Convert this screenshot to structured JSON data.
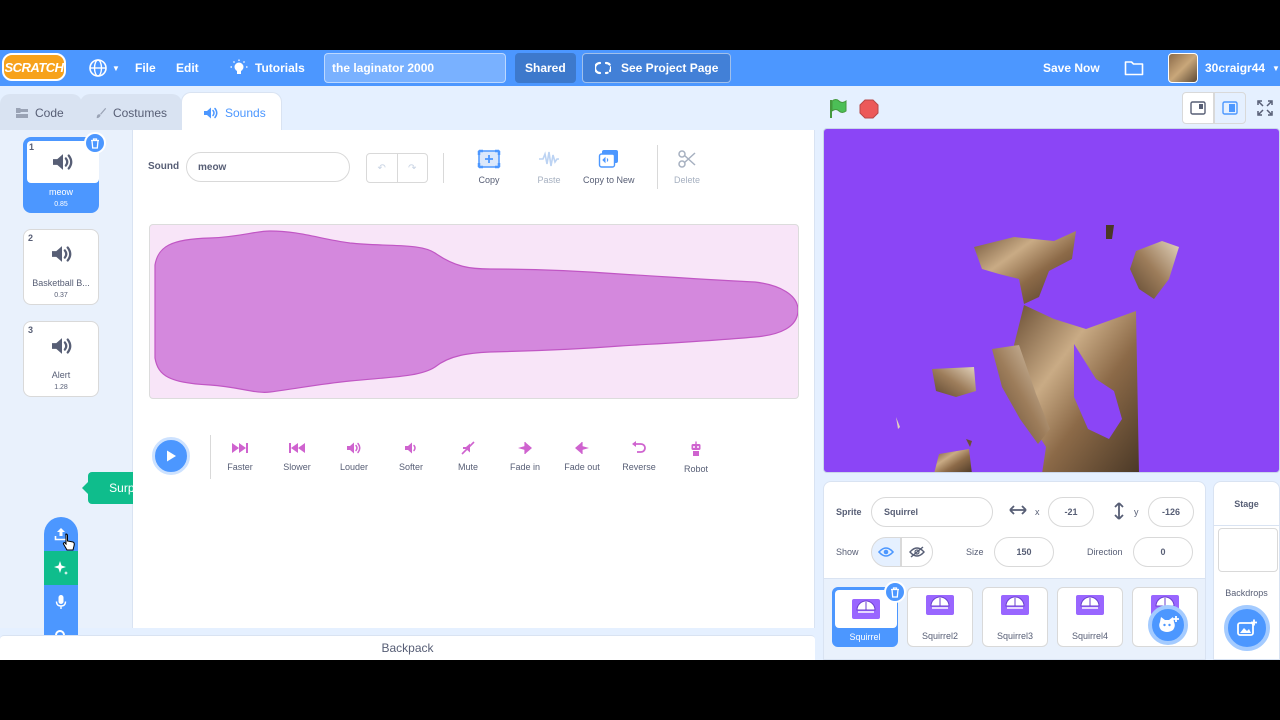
{
  "menubar": {
    "logo": "SCRATCH",
    "file": "File",
    "edit": "Edit",
    "tutorials": "Tutorials",
    "project_title": "the laginator 2000",
    "shared": "Shared",
    "see_project": "See Project Page",
    "save_now": "Save Now",
    "username": "30craigr44"
  },
  "tabs": {
    "code": "Code",
    "costumes": "Costumes",
    "sounds": "Sounds"
  },
  "sounds": [
    {
      "num": "1",
      "name": "meow",
      "duration": "0.85"
    },
    {
      "num": "2",
      "name": "Basketball B...",
      "duration": "0.37"
    },
    {
      "num": "3",
      "name": "Alert",
      "duration": "1.28"
    }
  ],
  "tooltip": "Surprise",
  "editor": {
    "sound_label": "Sound",
    "sound_name": "meow",
    "tools": {
      "copy": "Copy",
      "paste": "Paste",
      "copy_to_new": "Copy to New",
      "delete": "Delete"
    },
    "effects": [
      "Faster",
      "Slower",
      "Louder",
      "Softer",
      "Mute",
      "Fade in",
      "Fade out",
      "Reverse",
      "Robot"
    ]
  },
  "backpack": "Backpack",
  "sprite_info": {
    "sprite_label": "Sprite",
    "sprite_name": "Squirrel",
    "x_label": "x",
    "x": "-21",
    "y_label": "y",
    "y": "-126",
    "show_label": "Show",
    "size_label": "Size",
    "size": "150",
    "direction_label": "Direction",
    "direction": "0"
  },
  "sprites": [
    "Squirrel",
    "Squirrel2",
    "Squirrel3",
    "Squirrel4",
    "S"
  ],
  "stage_panel": {
    "title": "Stage",
    "backdrops": "Backdrops"
  },
  "colors": {
    "brand_blue": "#4c97ff",
    "stage_bg": "#8b45f6",
    "extension_green": "#0fbd8c",
    "sound_wave": "#cf63cf"
  }
}
